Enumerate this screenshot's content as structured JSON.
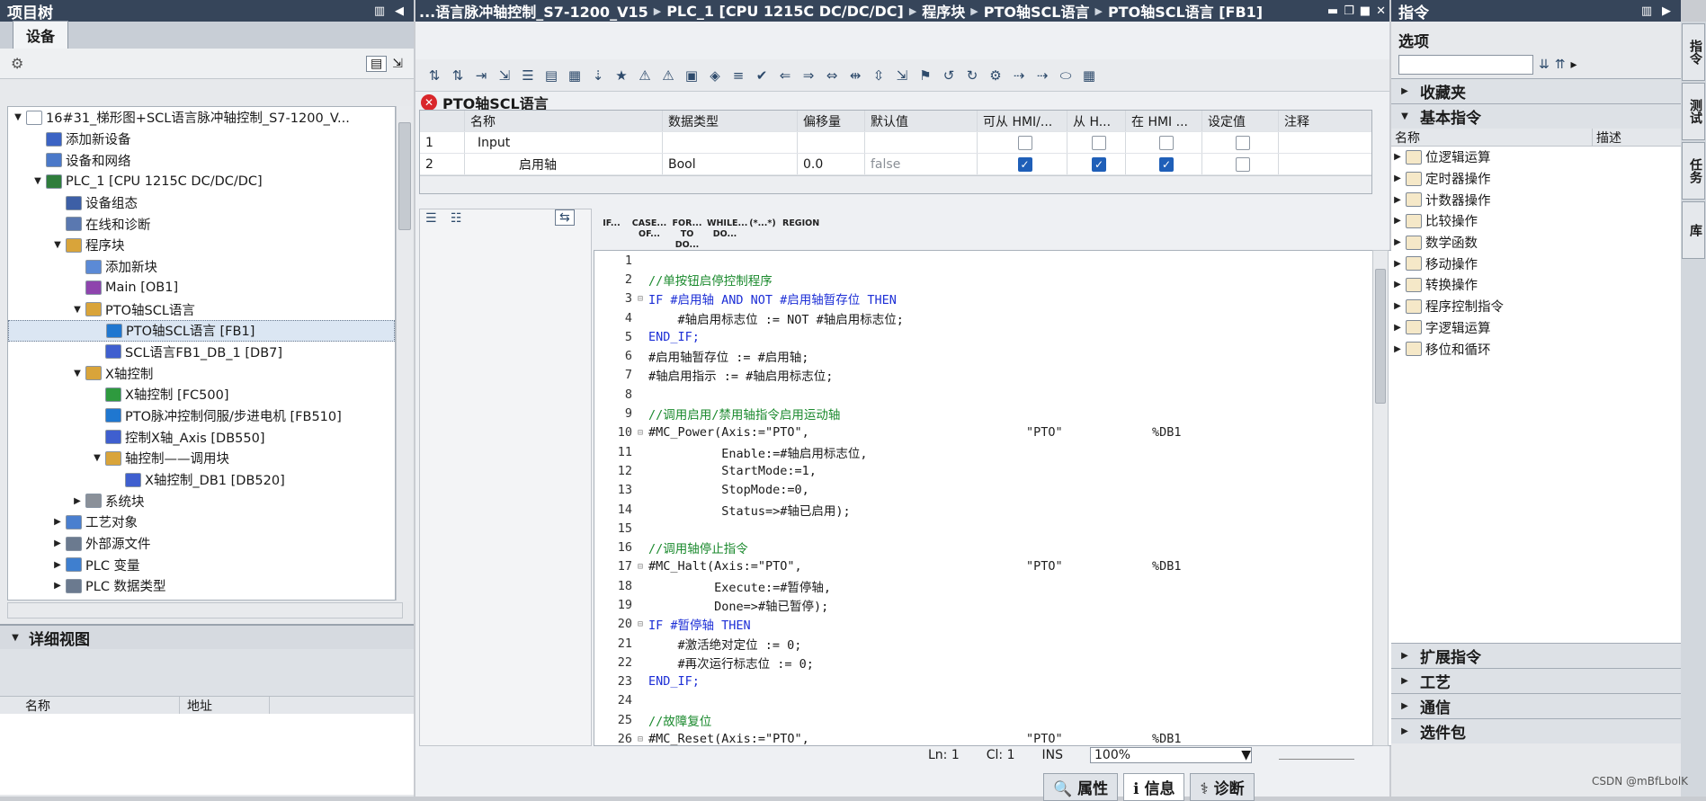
{
  "left": {
    "title": "项目树",
    "tab": "设备",
    "tree": [
      {
        "label": "16#31_梯形图+SCL语言脉冲轴控制_S7-1200_V...",
        "indent": 0,
        "tw": "▼",
        "color": "#ffffff"
      },
      {
        "label": "添加新设备",
        "indent": 1,
        "tw": "",
        "color": "#3b63c4"
      },
      {
        "label": "设备和网络",
        "indent": 1,
        "tw": "",
        "color": "#4b79c9"
      },
      {
        "label": "PLC_1 [CPU 1215C DC/DC/DC]",
        "indent": 1,
        "tw": "▼",
        "color": "#2f7d3c"
      },
      {
        "label": "设备组态",
        "indent": 2,
        "tw": "",
        "color": "#3d5fa6"
      },
      {
        "label": "在线和诊断",
        "indent": 2,
        "tw": "",
        "color": "#5a78b0"
      },
      {
        "label": "程序块",
        "indent": 2,
        "tw": "▼",
        "color": "#d9a43a"
      },
      {
        "label": "添加新块",
        "indent": 3,
        "tw": "",
        "color": "#5b8ad6"
      },
      {
        "label": "Main [OB1]",
        "indent": 3,
        "tw": "",
        "color": "#8e44ad"
      },
      {
        "label": "PTO轴SCL语言",
        "indent": 3,
        "tw": "▼",
        "color": "#d9a43a"
      },
      {
        "label": "PTO轴SCL语言 [FB1]",
        "indent": 4,
        "tw": "",
        "color": "#1f77d0",
        "selected": true
      },
      {
        "label": "SCL语言FB1_DB_1 [DB7]",
        "indent": 4,
        "tw": "",
        "color": "#3f5fcf"
      },
      {
        "label": "X轴控制",
        "indent": 3,
        "tw": "▼",
        "color": "#d9a43a"
      },
      {
        "label": "X轴控制 [FC500]",
        "indent": 4,
        "tw": "",
        "color": "#2e9a3e"
      },
      {
        "label": "PTO脉冲控制伺服/步进电机 [FB510]",
        "indent": 4,
        "tw": "",
        "color": "#1f77d0"
      },
      {
        "label": "控制X轴_Axis [DB550]",
        "indent": 4,
        "tw": "",
        "color": "#3f5fcf"
      },
      {
        "label": "轴控制——调用块",
        "indent": 4,
        "tw": "▼",
        "color": "#d9a43a"
      },
      {
        "label": "X轴控制_DB1 [DB520]",
        "indent": 5,
        "tw": "",
        "color": "#3f5fcf"
      },
      {
        "label": "系统块",
        "indent": 3,
        "tw": "▶",
        "color": "#8a9099"
      },
      {
        "label": "工艺对象",
        "indent": 2,
        "tw": "▶",
        "color": "#4a7fcf"
      },
      {
        "label": "外部源文件",
        "indent": 2,
        "tw": "▶",
        "color": "#6b7a8f"
      },
      {
        "label": "PLC 变量",
        "indent": 2,
        "tw": "▶",
        "color": "#3f7fcf"
      },
      {
        "label": "PLC 数据类型",
        "indent": 2,
        "tw": "▶",
        "color": "#6b7a8f"
      }
    ],
    "detail_title": "详细视图",
    "detail_cols": [
      "名称",
      "地址"
    ]
  },
  "center": {
    "breadcrumb": [
      "...语言脉冲轴控制_S7-1200_V15",
      "PLC_1 [CPU 1215C DC/DC/DC]",
      "程序块",
      "PTO轴SCL语言",
      "PTO轴SCL语言 [FB1]"
    ],
    "block_title": "PTO轴SCL语言",
    "iface_head": [
      "名称",
      "数据类型",
      "偏移量",
      "默认值",
      "可从 HMI/...",
      "从 H...",
      "在 HMI ...",
      "设定值",
      "注释"
    ],
    "iface_rows": [
      {
        "num": "1",
        "name": "Input",
        "type": "",
        "offset": "",
        "default": "",
        "c1": false,
        "c2": false,
        "c3": false,
        "c4": false
      },
      {
        "num": "2",
        "name": "启用轴",
        "type": "Bool",
        "offset": "0.0",
        "default": "false",
        "c1": true,
        "c2": true,
        "c3": true,
        "c4": false
      }
    ],
    "lang_buttons": [
      "IF...",
      "CASE... OF...",
      "FOR... TO DO...",
      "WHILE... DO...",
      "(*...*)",
      "REGION"
    ],
    "code": [
      {
        "n": "1",
        "t": "",
        "cls": ""
      },
      {
        "n": "2",
        "t": "//单按钮启停控制程序",
        "cls": "cm"
      },
      {
        "n": "3",
        "t": "IF #启用轴 AND NOT #启用轴暂存位 THEN",
        "cls": "kw",
        "fold": "⊟"
      },
      {
        "n": "4",
        "t": "    #轴启用标志位 := NOT #轴启用标志位;",
        "cls": ""
      },
      {
        "n": "5",
        "t": "END_IF;",
        "cls": "kw"
      },
      {
        "n": "6",
        "t": "#启用轴暂存位 := #启用轴;",
        "cls": ""
      },
      {
        "n": "7",
        "t": "#轴启用指示 := #轴启用标志位;",
        "cls": ""
      },
      {
        "n": "8",
        "t": "",
        "cls": ""
      },
      {
        "n": "9",
        "t": "//调用启用/禁用轴指令启用运动轴",
        "cls": "cm"
      },
      {
        "n": "10",
        "t": "#MC_Power(Axis:=\"PTO\",",
        "cls": "",
        "fold": "⊟",
        "r1": "\"PTO\"",
        "r2": "%DB1"
      },
      {
        "n": "11",
        "t": "          Enable:=#轴启用标志位,",
        "cls": ""
      },
      {
        "n": "12",
        "t": "          StartMode:=1,",
        "cls": ""
      },
      {
        "n": "13",
        "t": "          StopMode:=0,",
        "cls": ""
      },
      {
        "n": "14",
        "t": "          Status=>#轴已启用);",
        "cls": ""
      },
      {
        "n": "15",
        "t": "",
        "cls": ""
      },
      {
        "n": "16",
        "t": "//调用轴停止指令",
        "cls": "cm"
      },
      {
        "n": "17",
        "t": "#MC_Halt(Axis:=\"PTO\",",
        "cls": "",
        "fold": "⊟",
        "r1": "\"PTO\"",
        "r2": "%DB1"
      },
      {
        "n": "18",
        "t": "         Execute:=#暂停轴,",
        "cls": ""
      },
      {
        "n": "19",
        "t": "         Done=>#轴已暂停);",
        "cls": ""
      },
      {
        "n": "20",
        "t": "IF #暂停轴 THEN",
        "cls": "kw",
        "fold": "⊟"
      },
      {
        "n": "21",
        "t": "    #激活绝对定位 := 0;",
        "cls": ""
      },
      {
        "n": "22",
        "t": "    #再次运行标志位 := 0;",
        "cls": ""
      },
      {
        "n": "23",
        "t": "END_IF;",
        "cls": "kw"
      },
      {
        "n": "24",
        "t": "",
        "cls": ""
      },
      {
        "n": "25",
        "t": "//故障复位",
        "cls": "cm"
      },
      {
        "n": "26",
        "t": "#MC_Reset(Axis:=\"PTO\",",
        "cls": "",
        "fold": "⊟",
        "r1": "\"PTO\"",
        "r2": "%DB1"
      }
    ],
    "status": {
      "ln": "Ln: 1",
      "cl": "Cl: 1",
      "mode": "INS",
      "zoom": "100%"
    },
    "bottom_tabs": [
      "属性",
      "信息",
      "诊断"
    ]
  },
  "right": {
    "title": "指令",
    "options": "选项",
    "favorites": "收藏夹",
    "basic": "基本指令",
    "cols": [
      "名称",
      "描述"
    ],
    "items": [
      "位逻辑运算",
      "定时器操作",
      "计数器操作",
      "比较操作",
      "数学函数",
      "移动操作",
      "转换操作",
      "程序控制指令",
      "字逻辑运算",
      "移位和循环"
    ],
    "sections": [
      "扩展指令",
      "工艺",
      "通信",
      "选件包"
    ],
    "vtabs": [
      "指令",
      "测试",
      "任务",
      "库"
    ],
    "watermark": "CSDN @mBfLbolK"
  }
}
